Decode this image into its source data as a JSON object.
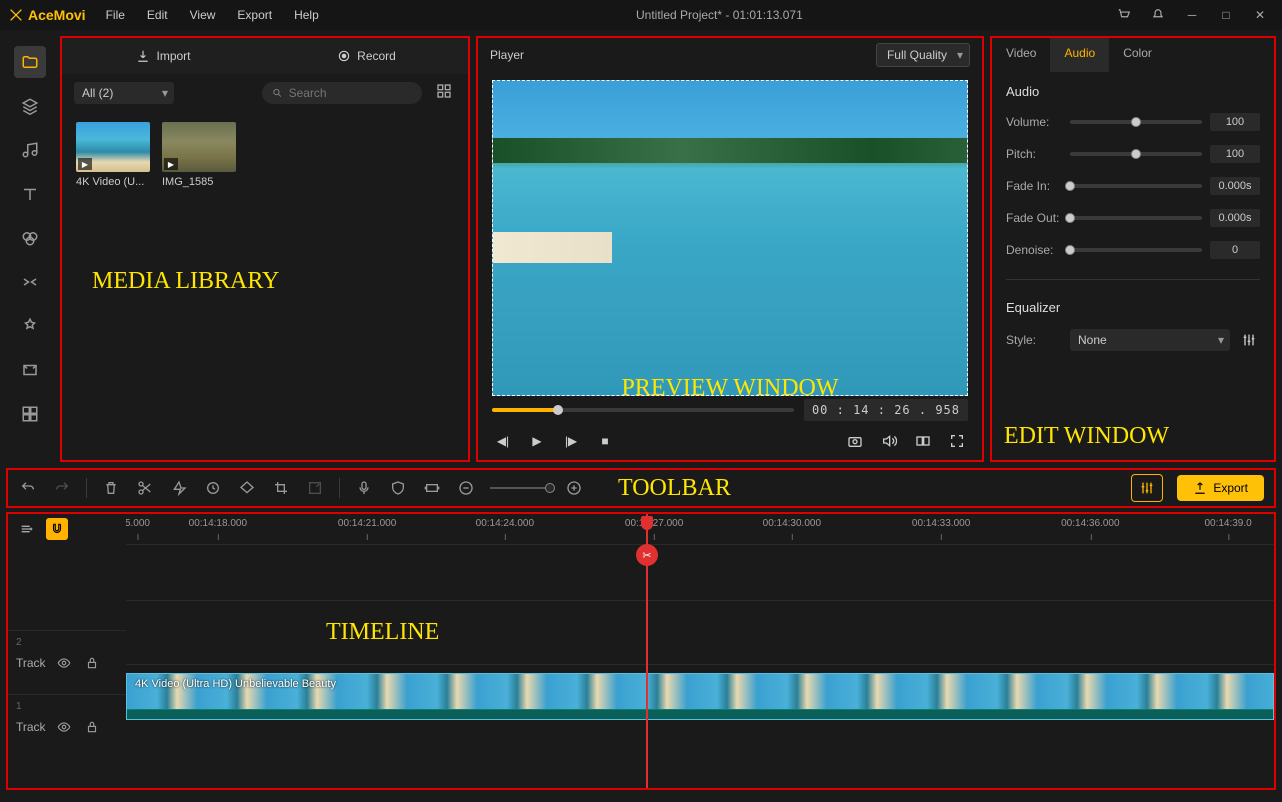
{
  "app": {
    "name": "AceMovi",
    "title": "Untitled Project* - 01:01:13.071"
  },
  "menu": [
    "File",
    "Edit",
    "View",
    "Export",
    "Help"
  ],
  "media": {
    "tabs": {
      "import": "Import",
      "record": "Record"
    },
    "filter": "All (2)",
    "search_placeholder": "Search",
    "items": [
      {
        "label": "4K Video (U..."
      },
      {
        "label": "IMG_1585"
      }
    ]
  },
  "player": {
    "title": "Player",
    "quality": "Full Quality",
    "timecode": "00 : 14 : 26 . 958"
  },
  "edit": {
    "tabs": [
      "Video",
      "Audio",
      "Color"
    ],
    "section": "Audio",
    "volume": {
      "label": "Volume:",
      "value": "100"
    },
    "pitch": {
      "label": "Pitch:",
      "value": "100"
    },
    "fadein": {
      "label": "Fade In:",
      "value": "0.000s"
    },
    "fadeout": {
      "label": "Fade Out:",
      "value": "0.000s"
    },
    "denoise": {
      "label": "Denoise:",
      "value": "0"
    },
    "equalizer": {
      "title": "Equalizer",
      "style_label": "Style:",
      "style_value": "None"
    }
  },
  "toolbar": {
    "export": "Export"
  },
  "timeline": {
    "ruler": [
      "5.000",
      "00:14:18.000",
      "00:14:21.000",
      "00:14:24.000",
      "00:14:27.000",
      "00:14:30.000",
      "00:14:33.000",
      "00:14:36.000",
      "00:14:39.0"
    ],
    "track2": {
      "num": "2",
      "label": "Track"
    },
    "track1": {
      "num": "1",
      "label": "Track",
      "clip": "4K Video (Ultra HD) Unbelievable Beauty"
    }
  },
  "annot": {
    "media": "MEDIA LIBRARY",
    "preview": "PREVIEW WINDOW",
    "edit": "EDIT WINDOW",
    "toolbar": "TOOLBAR",
    "timeline": "TIMELINE"
  }
}
